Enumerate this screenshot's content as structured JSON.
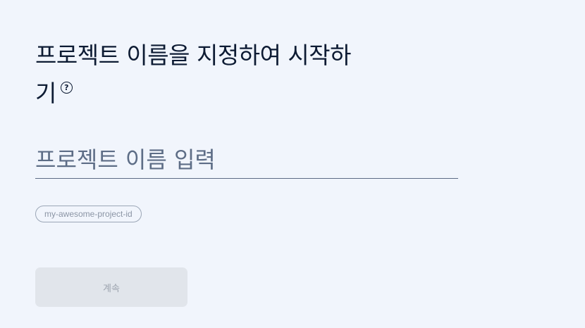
{
  "title": {
    "text": "프로젝트 이름을 지정하여 시작하기",
    "help_icon": "?"
  },
  "name_input": {
    "placeholder": "프로젝트 이름 입력",
    "value": ""
  },
  "project_id_chip": {
    "text": "my-awesome-project-id"
  },
  "continue_button": {
    "label": "계속",
    "disabled": true
  }
}
